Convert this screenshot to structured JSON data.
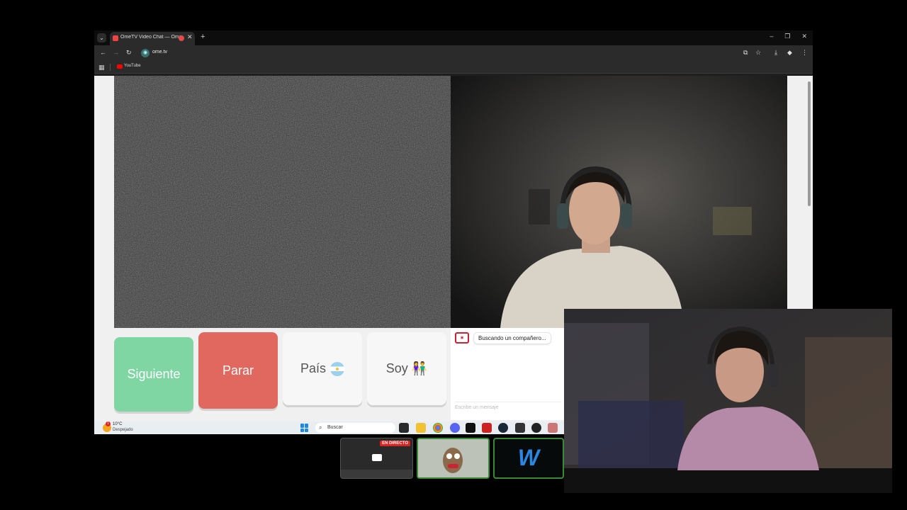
{
  "browser": {
    "tab_title": "OmeTV Video Chat — Ome",
    "url": "ome.tv",
    "bookmark_youtube": "YouTube"
  },
  "controls": {
    "next_label": "Siguiente",
    "stop_label": "Parar",
    "country_label": "País",
    "gender_label": "Soy",
    "gender_emoji": "👫"
  },
  "chat": {
    "status": "Buscando un compañero...",
    "input_placeholder": "Escribe un mensaje"
  },
  "taskbar": {
    "temperature": "10°C",
    "weather": "Despejado",
    "search_placeholder": "Buscar",
    "weather_badge": "1"
  },
  "thumbnails": {
    "live_badge": "EN DIRECTO",
    "w_logo": "W"
  },
  "colors": {
    "next_green": "#7fd6a3",
    "stop_red": "#e0685e",
    "accent_blue": "#2a86e0"
  }
}
